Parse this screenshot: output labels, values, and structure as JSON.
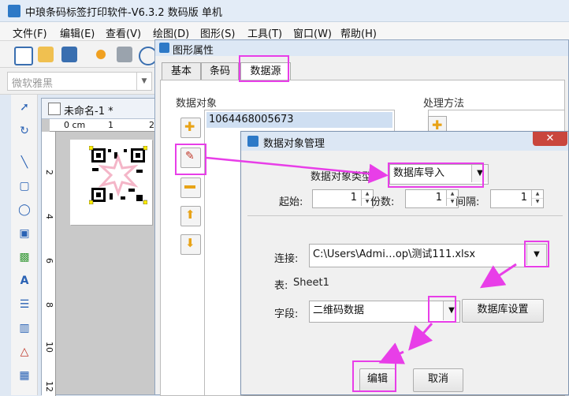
{
  "app": {
    "title": "中琅条码标签打印软件-V6.3.2 数码版 单机"
  },
  "menu": [
    "文件(F)",
    "编辑(E)",
    "查看(V)",
    "绘图(D)",
    "图形(S)",
    "工具(T)",
    "窗口(W)",
    "帮助(H)"
  ],
  "font_bar": {
    "font_name": "微软雅黑"
  },
  "document": {
    "tab_title": "未命名-1 *",
    "ruler_top": [
      "0 cm",
      "1",
      "2"
    ],
    "ruler_left": [
      "2",
      "4",
      "6",
      "8",
      "10",
      "12"
    ]
  },
  "properties_dialog": {
    "title": "图形属性",
    "tabs": [
      "基本",
      "条码",
      "数据源"
    ],
    "active_tab": "数据源",
    "data_objects_label": "数据对象",
    "processing_label": "处理方法",
    "data_objects": [
      "1064468005673"
    ]
  },
  "data_manager": {
    "title": "数据对象管理",
    "type_label": "数据对象类型:",
    "type_value": "数据库导入",
    "start_label": "起始:",
    "start_value": "1",
    "copies_label": "份数:",
    "copies_value": "1",
    "interval_label": "间隔:",
    "interval_value": "1",
    "connect_label": "连接:",
    "connect_value": "C:\\Users\\Admi…op\\测试111.xlsx",
    "table_label": "表:",
    "table_value": "Sheet1",
    "field_label": "字段:",
    "field_value": "二维码数据",
    "db_settings_button": "数据库设置",
    "edit_button": "编辑",
    "cancel_button": "取消"
  },
  "colors": {
    "highlight": "#e83ee8",
    "accent": "#2d79c7"
  }
}
